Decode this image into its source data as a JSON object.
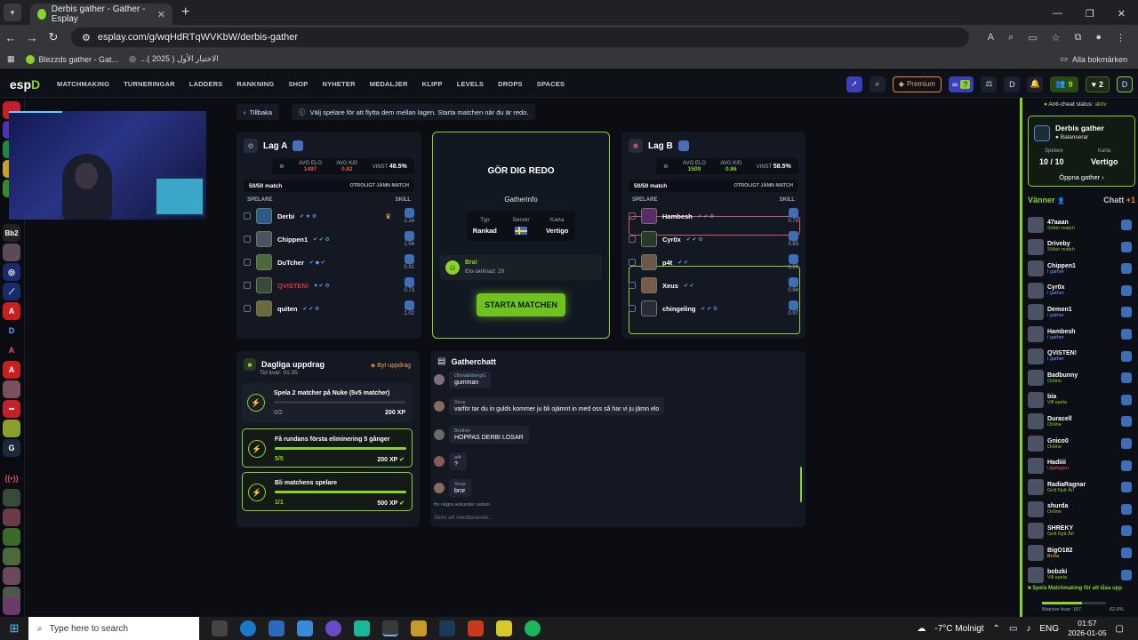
{
  "browser": {
    "tab_title": "Derbis gather - Gather - Esplay",
    "url": "esplay.com/g/wqHdRTqWVKbW/derbis-gather",
    "bookmarks": [
      "Blezzds gather - Gat...",
      "...الاختبار الأول ( 2025 )"
    ],
    "bookmarks_right": "Alla bokmärken"
  },
  "site": {
    "logo": "esp",
    "nav": [
      "MATCHMAKING",
      "TURNERINGAR",
      "LADDERS",
      "RANKNING",
      "SHOP",
      "NYHETER",
      "MEDALJER",
      "KLIPP",
      "LEVELS",
      "DROPS",
      "SPACES"
    ],
    "premium": "Premium",
    "friends_count": "9",
    "hearts_count": "2"
  },
  "topbar": {
    "back": "Tillbaka",
    "info": "Välj spelare för att flytta dem mellan lagen. Starta matchen när du är redo."
  },
  "team_a": {
    "name": "Lag A",
    "avg_elo_label": "AVG ELO",
    "avg_elo": "1497",
    "avg_kd_label": "AVG K/D",
    "avg_kd": "0.82",
    "win_label": "VINST",
    "win": "48.5%",
    "match_label": "50/50 match",
    "match_right": "OTROLIGT JÄMN MATCH",
    "col_players": "SPELARE",
    "col_skill": "SKILL",
    "players": [
      {
        "name": "Derbi",
        "skill": "1.14"
      },
      {
        "name": "Chippen1",
        "skill": "1.04"
      },
      {
        "name": "DuTcher",
        "skill": "0.91"
      },
      {
        "name": "QVISTEN!",
        "skill": "0.73"
      },
      {
        "name": "quiten",
        "skill": "1.02"
      }
    ]
  },
  "team_b": {
    "name": "Lag B",
    "avg_elo_label": "AVG ELO",
    "avg_elo": "1509",
    "avg_kd_label": "AVG K/D",
    "avg_kd": "0.86",
    "win_label": "VINST",
    "win": "58.5%",
    "match_label": "50/50 match",
    "match_right": "OTROLIGT JÄMN MATCH",
    "col_players": "SPELARE",
    "col_skill": "SKILL",
    "players": [
      {
        "name": "Hambesh",
        "skill": "0.79"
      },
      {
        "name": "Cyr0x",
        "skill": "0.83"
      },
      {
        "name": "p4t",
        "skill": "1.20"
      },
      {
        "name": "Xeus",
        "skill": "0.94"
      },
      {
        "name": "chingeling",
        "skill": "0.97"
      }
    ]
  },
  "ready": {
    "title": "GÖR DIG REDO",
    "gatherinfo": "Gatherinfo",
    "typ_label": "Typ",
    "typ": "Rankad",
    "server_label": "Server",
    "karta_label": "Karta",
    "karta": "Vertigo",
    "bra_title": "Bra!",
    "bra_text": "Elo-skillnad: 29",
    "start": "STARTA MATCHEN"
  },
  "daily": {
    "title": "Dagliga uppdrag",
    "time": "Tid kvar: 01:35",
    "swap": "Byt uppdrag",
    "quests": [
      {
        "title": "Spela 2 matcher på Nuke (5v5 matcher)",
        "progress": "0/2",
        "xp": "200 XP",
        "fraction": 0
      },
      {
        "title": "Få rundans första eliminering 5 gånger",
        "progress": "5/5",
        "xp": "200 XP",
        "fraction": 1
      },
      {
        "title": "Bli matchens spelare",
        "progress": "1/1",
        "xp": "500 XP",
        "fraction": 1
      }
    ]
  },
  "chat": {
    "title": "Gatherchatt",
    "messages": [
      {
        "name": "OliviaEkbergG",
        "text": "gumman"
      },
      {
        "name": "Xeus",
        "text": "varför tar du in gulds kommer ju bli ojämnt in med oss så har vi ju jämn elo"
      },
      {
        "name": "Brother",
        "text": "HOPPAS DERBI LOSAR"
      },
      {
        "name": "p4t",
        "text": "?"
      },
      {
        "name": "Xeus",
        "text": "bror"
      }
    ],
    "timestamp": "för några sekunder sedan",
    "placeholder": "Skriv ett meddelande..."
  },
  "right": {
    "anticheat_label": "Anti-cheat status:",
    "anticheat_value": "aktiv",
    "gather_name": "Derbis gather",
    "gather_status": "Balanserar",
    "spelare_label": "Spelare",
    "spelare": "10 / 10",
    "karta_label": "Karta",
    "karta": "Vertigo",
    "open": "Öppna gather",
    "tab_friends": "Vänner",
    "tab_chat": "Chatt",
    "chat_count": "+1",
    "friends": [
      {
        "name": "47aaan",
        "status": "Söker match",
        "color": "#8ad32a"
      },
      {
        "name": "Driveby",
        "status": "Söker match",
        "color": "#8ad32a"
      },
      {
        "name": "Chippen1",
        "status": "I gather",
        "color": "#6aa0ff"
      },
      {
        "name": "Cyr0x",
        "status": "I gather",
        "color": "#6aa0ff"
      },
      {
        "name": "Demon1",
        "status": "I gather",
        "color": "#6aa0ff"
      },
      {
        "name": "Hambesh",
        "status": "I gather",
        "color": "#6aa0ff"
      },
      {
        "name": "QVISTEN!",
        "status": "I gather",
        "color": "#6aa0ff"
      },
      {
        "name": "Badbunny",
        "status": "Online",
        "color": "#8ad32a"
      },
      {
        "name": "bia",
        "status": "Vill spela",
        "color": "#8ad32a"
      },
      {
        "name": "Duracell",
        "status": "Online",
        "color": "#8ad32a"
      },
      {
        "name": "Gnico0",
        "status": "Online",
        "color": "#8ad32a"
      },
      {
        "name": "Hadiiii",
        "status": "Upptagen",
        "color": "#e05555"
      },
      {
        "name": "RadiaRagnar",
        "status": "Gott Nytt År!",
        "color": "#8ad32a"
      },
      {
        "name": "shurda",
        "status": "Online",
        "color": "#8ad32a"
      },
      {
        "name": "SHREKY",
        "status": "Gott Nytt År!",
        "color": "#8ad32a"
      },
      {
        "name": "BigO182",
        "status": "Borta",
        "color": "#f3c23a"
      },
      {
        "name": "bobzki",
        "status": "Vill spela",
        "color": "#8ad32a"
      }
    ],
    "footer_title": "Spela Matchmaking för att låsa upp",
    "footer_sub": "Matcher kvar: 187",
    "footer_pct": "62.6%"
  },
  "taskbar": {
    "search": "Type here to search",
    "weather": "-7°C  Molnigt",
    "lang": "ENG",
    "time": "01:57",
    "date": "2026-01-05"
  }
}
